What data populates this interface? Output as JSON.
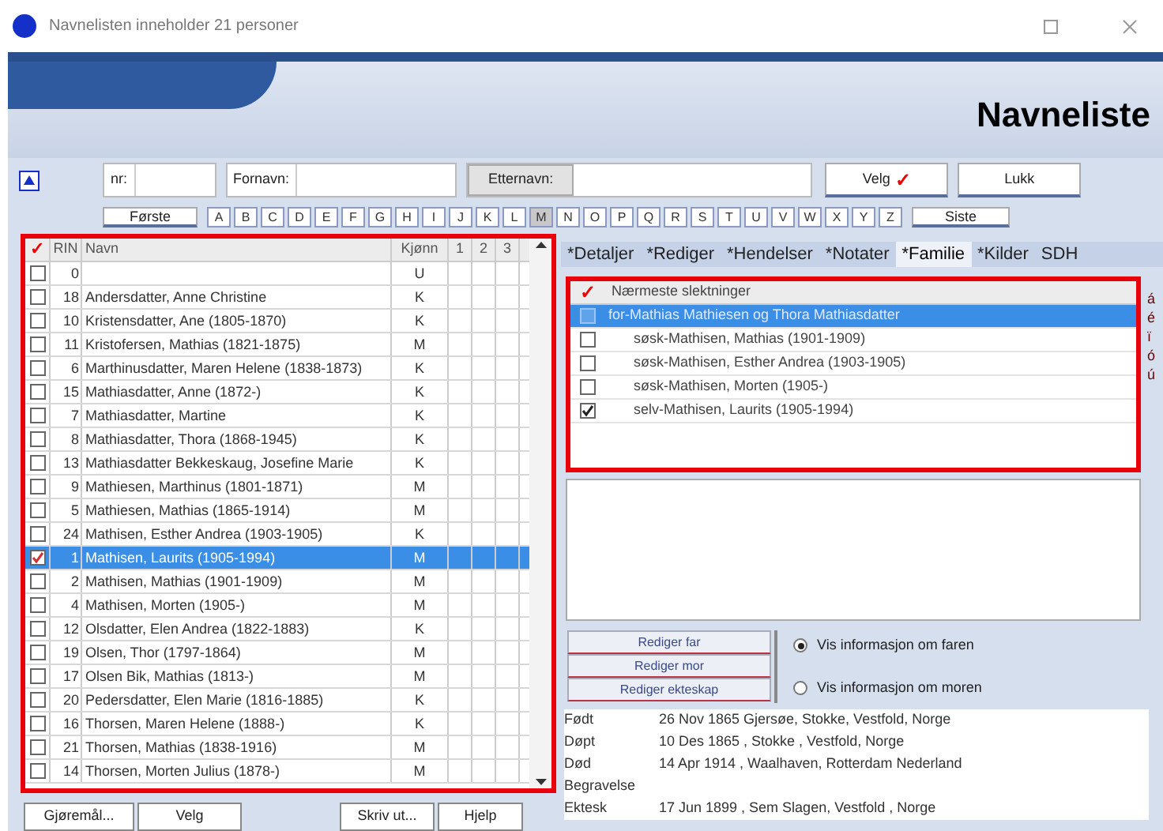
{
  "window": {
    "title": "Navnelisten inneholder 21 personer",
    "heading": "Navneliste"
  },
  "search": {
    "fields": [
      {
        "label": "nr:"
      },
      {
        "label": "Fornavn:"
      },
      {
        "label": "Etternavn:"
      }
    ],
    "buttons": [
      {
        "label": "Velg",
        "tick": "✓"
      },
      {
        "label": "Lukk"
      }
    ]
  },
  "alphabet": {
    "first": "Første",
    "last": "Siste",
    "letters": [
      {
        "label": "A",
        "selected": false
      },
      {
        "label": "B",
        "selected": false
      },
      {
        "label": "C",
        "selected": false
      },
      {
        "label": "D",
        "selected": false
      },
      {
        "label": "E",
        "selected": false
      },
      {
        "label": "F",
        "selected": false
      },
      {
        "label": "G",
        "selected": false
      },
      {
        "label": "H",
        "selected": false
      },
      {
        "label": "I",
        "selected": false
      },
      {
        "label": "J",
        "selected": false
      },
      {
        "label": "K",
        "selected": false
      },
      {
        "label": "L",
        "selected": false
      },
      {
        "label": "M",
        "selected": true
      },
      {
        "label": "N",
        "selected": false
      },
      {
        "label": "O",
        "selected": false
      },
      {
        "label": "P",
        "selected": false
      },
      {
        "label": "Q",
        "selected": false
      },
      {
        "label": "R",
        "selected": false
      },
      {
        "label": "S",
        "selected": false
      },
      {
        "label": "T",
        "selected": false
      },
      {
        "label": "U",
        "selected": false
      },
      {
        "label": "V",
        "selected": false
      },
      {
        "label": "W",
        "selected": false
      },
      {
        "label": "X",
        "selected": false
      },
      {
        "label": "Y",
        "selected": false
      },
      {
        "label": "Z",
        "selected": false
      }
    ]
  },
  "table": {
    "columns": [
      "✓",
      "RIN",
      "Navn",
      "Kjønn",
      "1",
      "2",
      "3"
    ],
    "rows": [
      {
        "rin": "0",
        "name": "",
        "sex": "U",
        "checked": false,
        "selected": false
      },
      {
        "rin": "18",
        "name": "Andersdatter, Anne Christine",
        "sex": "K",
        "checked": false,
        "selected": false
      },
      {
        "rin": "10",
        "name": "Kristensdatter, Ane (1805-1870)",
        "sex": "K",
        "checked": false,
        "selected": false
      },
      {
        "rin": "11",
        "name": "Kristofersen, Mathias (1821-1875)",
        "sex": "M",
        "checked": false,
        "selected": false
      },
      {
        "rin": "6",
        "name": "Marthinusdatter, Maren Helene (1838-1873)",
        "sex": "K",
        "checked": false,
        "selected": false
      },
      {
        "rin": "15",
        "name": "Mathiasdatter, Anne (1872-)",
        "sex": "K",
        "checked": false,
        "selected": false
      },
      {
        "rin": "7",
        "name": "Mathiasdatter, Martine",
        "sex": "K",
        "checked": false,
        "selected": false
      },
      {
        "rin": "8",
        "name": "Mathiasdatter, Thora (1868-1945)",
        "sex": "K",
        "checked": false,
        "selected": false
      },
      {
        "rin": "13",
        "name": "Mathiasdatter Bekkeskaug, Josefine Marie",
        "sex": "K",
        "checked": false,
        "selected": false
      },
      {
        "rin": "9",
        "name": "Mathiesen, Marthinus (1801-1871)",
        "sex": "M",
        "checked": false,
        "selected": false
      },
      {
        "rin": "5",
        "name": "Mathiesen, Mathias (1865-1914)",
        "sex": "M",
        "checked": false,
        "selected": false
      },
      {
        "rin": "24",
        "name": "Mathisen, Esther Andrea (1903-1905)",
        "sex": "K",
        "checked": false,
        "selected": false
      },
      {
        "rin": "1",
        "name": "Mathisen, Laurits (1905-1994)",
        "sex": "M",
        "checked": true,
        "selected": true
      },
      {
        "rin": "2",
        "name": "Mathisen, Mathias (1901-1909)",
        "sex": "M",
        "checked": false,
        "selected": false
      },
      {
        "rin": "4",
        "name": "Mathisen, Morten (1905-)",
        "sex": "M",
        "checked": false,
        "selected": false
      },
      {
        "rin": "12",
        "name": "Olsdatter, Elen Andrea (1822-1883)",
        "sex": "K",
        "checked": false,
        "selected": false
      },
      {
        "rin": "19",
        "name": "Olsen, Thor (1797-1864)",
        "sex": "M",
        "checked": false,
        "selected": false
      },
      {
        "rin": "17",
        "name": "Olsen Bik, Mathias (1813-)",
        "sex": "M",
        "checked": false,
        "selected": false
      },
      {
        "rin": "20",
        "name": "Pedersdatter, Elen Marie (1816-1885)",
        "sex": "K",
        "checked": false,
        "selected": false
      },
      {
        "rin": "16",
        "name": "Thorsen, Maren Helene (1888-)",
        "sex": "K",
        "checked": false,
        "selected": false
      },
      {
        "rin": "21",
        "name": "Thorsen, Mathias (1838-1916)",
        "sex": "M",
        "checked": false,
        "selected": false
      },
      {
        "rin": "14",
        "name": "Thorsen, Morten Julius (1878-)",
        "sex": "M",
        "checked": false,
        "selected": false
      }
    ]
  },
  "bottom_buttons": [
    "Gjøremål...",
    "Velg",
    "Skriv ut...",
    "Hjelp"
  ],
  "tabs": [
    {
      "label": "*Detaljer",
      "selected": false
    },
    {
      "label": "*Rediger",
      "selected": false
    },
    {
      "label": "*Hendelser",
      "selected": false
    },
    {
      "label": "*Notater",
      "selected": false
    },
    {
      "label": "*Familie",
      "selected": true
    },
    {
      "label": "*Kilder",
      "selected": false
    },
    {
      "label": "SDH",
      "selected": false
    }
  ],
  "family": {
    "header": "Nærmeste slektninger",
    "mark": "✓",
    "rows": [
      {
        "label": "for-Mathias Mathiesen og Thora Mathiasdatter",
        "checked": false,
        "selected": true,
        "children": [
          {
            "label": "søsk-Mathisen, Mathias (1901-1909)",
            "checked": false,
            "selected": false
          },
          {
            "label": "søsk-Mathisen, Esther Andrea (1903-1905)",
            "checked": false,
            "selected": false
          },
          {
            "label": "søsk-Mathisen, Morten (1905-)",
            "checked": false,
            "selected": false
          },
          {
            "label": "selv-Mathisen, Laurits (1905-1994)",
            "checked": true,
            "selected": false
          }
        ]
      }
    ]
  },
  "side_strip": [
    "á",
    "é",
    "ï",
    "ó",
    "ú"
  ],
  "edit_buttons": [
    "Rediger far",
    "Rediger mor",
    "Rediger ekteskap"
  ],
  "radios": [
    {
      "label": "Vis informasjon om faren",
      "selected": true
    },
    {
      "label": "Vis informasjon om moren",
      "selected": false
    }
  ],
  "events": [
    {
      "label": "Født",
      "value": "26 Nov 1865 Gjersøe, Stokke, Vestfold, Norge"
    },
    {
      "label": "Døpt",
      "value": "10 Des 1865 , Stokke , Vestfold, Norge"
    },
    {
      "label": "Død",
      "value": "14 Apr 1914 , Waalhaven, Rotterdam Nederland"
    },
    {
      "label": "Begravelse"
    },
    {
      "label": "Ektesk",
      "value": "17 Jun 1899 , Sem Slagen, Vestfold , Norge"
    }
  ]
}
